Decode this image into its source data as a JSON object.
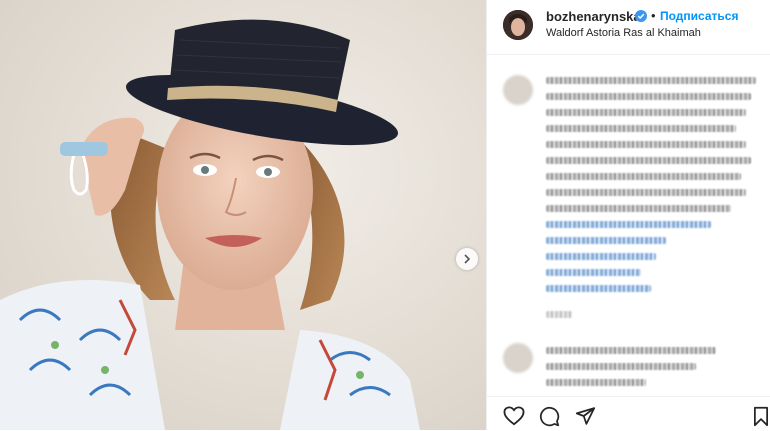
{
  "post": {
    "username": "bozhenarynska",
    "verified": true,
    "follow_label": "Подписаться",
    "separator": "•",
    "location": "Waldorf Astoria Ras al Khaimah",
    "more_label": "···"
  },
  "photo": {
    "icon": "chevron-right-icon"
  },
  "actions": {
    "icons": [
      "heart-icon",
      "comment-icon",
      "share-icon",
      "bookmark-icon"
    ]
  },
  "colors": {
    "accent": "#0095f6",
    "verified": "#3897f0",
    "text": "#262626",
    "border": "#efefef"
  }
}
